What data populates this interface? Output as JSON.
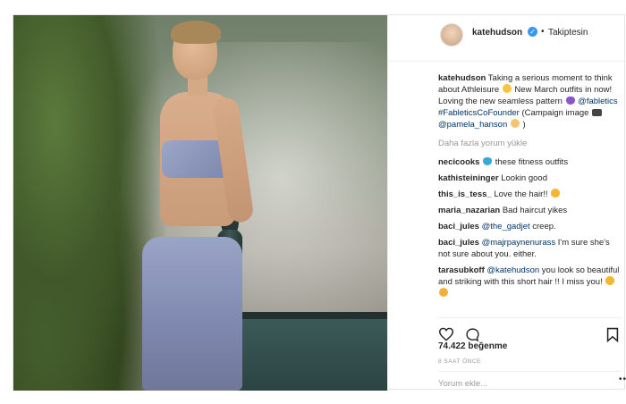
{
  "post": {
    "username": "katehudson",
    "follow_status": "Takiptesin",
    "separator": "•",
    "caption": {
      "author": "katehudson",
      "text_1": "Taking a serious moment to think about Athleisure",
      "text_2": "New March outfits in now! Loving the new seamless pattern",
      "mention_1": "@fabletics",
      "hashtag": "#FableticsCoFounder",
      "text_3": "(Campaign image",
      "mention_2": "@pamela_hanson",
      "text_4": ")"
    },
    "load_more": "Daha fazla yorum yükle",
    "comments": [
      {
        "user": "necicooks",
        "text": "these fitness outfits"
      },
      {
        "user": "kathisteininger",
        "text": "Lookin good"
      },
      {
        "user": "this_is_tess_",
        "text": "Love the hair!!"
      },
      {
        "user": "maria_nazarian",
        "text": "Bad haircut yikes"
      },
      {
        "user": "baci_jules",
        "mention": "@the_gadjet",
        "text": "creep."
      },
      {
        "user": "baci_jules",
        "mention": "@majrpaynenurass",
        "text": "I'm sure she's not sure about you. either."
      },
      {
        "user": "tarasubkoff",
        "mention": "@katehudson",
        "text": "you look so beautiful and striking with this short hair !! I miss you!"
      }
    ],
    "likes": "74.422 beğenme",
    "time": "8 SAAT ÖNCE",
    "add_comment_placeholder": "Yorum ekle...",
    "more": "•••"
  },
  "icons": {
    "verified": "verified-badge-icon",
    "like": "heart-outline-icon",
    "comment": "speech-bubble-icon",
    "bookmark": "bookmark-icon",
    "more": "more-dots-icon"
  },
  "colors": {
    "verified_blue": "#3897f0",
    "link": "#003569",
    "muted": "#999999",
    "text": "#262626"
  }
}
